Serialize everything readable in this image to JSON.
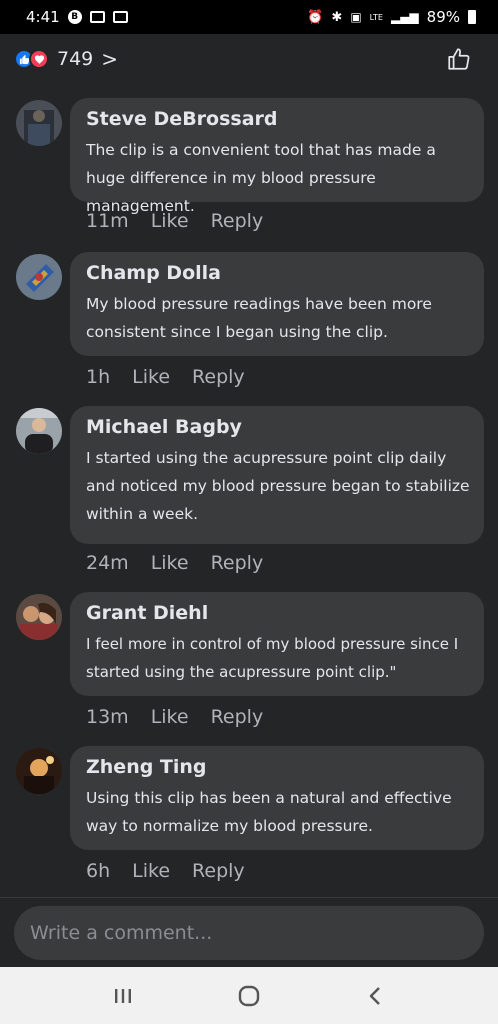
{
  "status": {
    "time": "4:41",
    "battery": "89%",
    "network": "LTE"
  },
  "reactions": {
    "count": "749",
    "chevron": ">",
    "icons": [
      "like-icon",
      "love-icon"
    ]
  },
  "comments": [
    {
      "name": "Steve DeBrossard",
      "text": "The clip is a convenient tool that has made a huge difference in my blood pressure management.",
      "time": "11m",
      "like": "Like",
      "reply": "Reply"
    },
    {
      "name": "Champ Dolla",
      "text": "My blood pressure readings have been more consistent since I began using the clip.",
      "time": "1h",
      "like": "Like",
      "reply": "Reply"
    },
    {
      "name": "Michael Bagby",
      "text": "I started using the acupressure point clip daily and noticed my blood pressure began to stabilize within a week.",
      "time": "24m",
      "like": "Like",
      "reply": "Reply"
    },
    {
      "name": "Grant Diehl",
      "text": "I feel more in control of my blood pressure since I started using the acupressure point clip.\"",
      "time": "13m",
      "like": "Like",
      "reply": "Reply"
    },
    {
      "name": "Zheng Ting",
      "text": "Using this clip has been a natural and effective way to normalize my blood pressure.",
      "time": "6h",
      "like": "Like",
      "reply": "Reply"
    }
  ],
  "composer": {
    "placeholder": "Write a comment..."
  },
  "colors": {
    "background": "#242526",
    "bubble": "#3a3b3c",
    "like_blue": "#1877f2",
    "love_red": "#f33e58"
  }
}
